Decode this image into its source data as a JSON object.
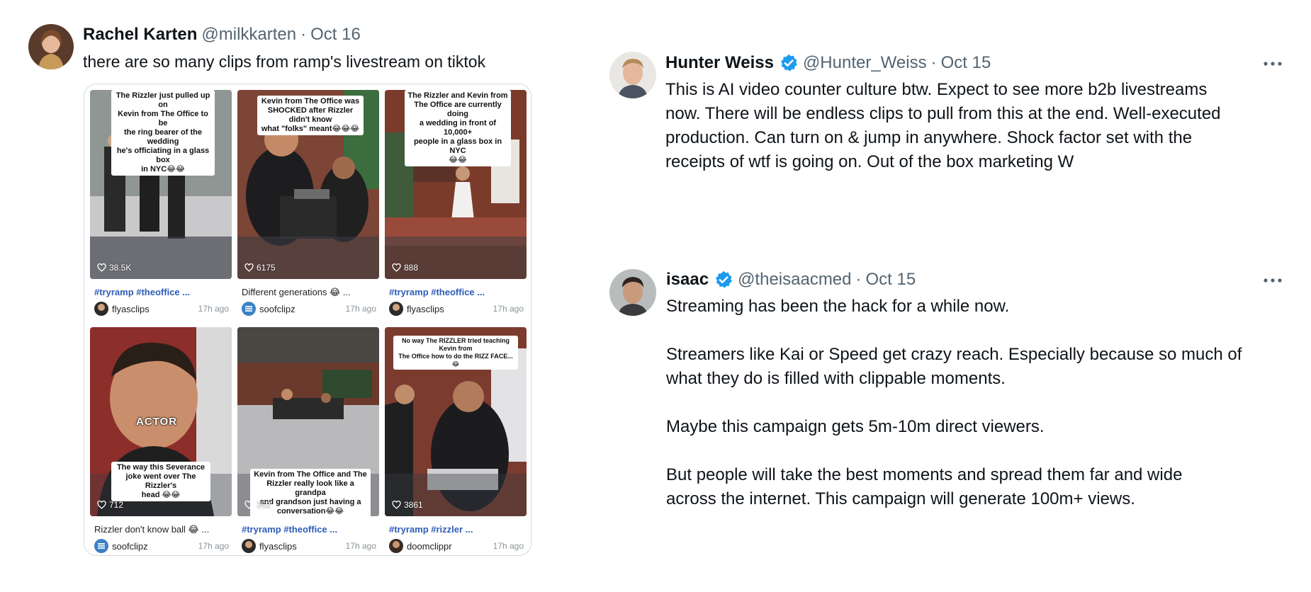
{
  "tweet1": {
    "name": "Rachel Karten",
    "handle": "@milkkarten",
    "separator": "·",
    "date": "Oct 16",
    "text": "there are so many clips from ramp's livestream on tiktok",
    "clips": [
      {
        "caption": [
          "The Rizzler just pulled up on",
          "Kevin from The Office to be",
          "the ring bearer of the wedding",
          "he's officiating in a glass box",
          "in NYC😂😂"
        ],
        "likes": "38.5K",
        "title": "#tryramp #theoffice ...",
        "user": "flyasclips",
        "ago": "17h ago"
      },
      {
        "caption": [
          "Kevin from The Office was",
          "SHOCKED after Rizzler didn't know",
          "what \"folks\" meant😂😂😂"
        ],
        "likes": "6175",
        "title": "Different generations 😂 ...",
        "user": "soofclipz",
        "ago": "17h ago"
      },
      {
        "caption": [
          "The Rizzler and Kevin from",
          "The Office are currently doing",
          "a wedding in front of 10,000+",
          "people in a glass box in NYC",
          "😂😂"
        ],
        "likes": "888",
        "title": "#tryramp #theoffice ...",
        "user": "flyasclips",
        "ago": "17h ago"
      },
      {
        "caption": [
          "The way this Severance",
          "joke went over The Rizzler's",
          "head 😂😂"
        ],
        "overlay": "ACTOR",
        "likes": "712",
        "title": "Rizzler don't know ball 😂 ...",
        "user": "soofclipz",
        "ago": "17h ago"
      },
      {
        "caption": [
          "Kevin from The Office and The",
          "Rizzler really look like a grandpa",
          "and grandson just having a",
          "conversation😂😂"
        ],
        "likes": "352",
        "title": "#tryramp #theoffice ...",
        "user": "flyasclips",
        "ago": "17h ago"
      },
      {
        "caption": [
          "No way The RIZZLER tried teaching Kevin from",
          "The Office how to do the RIZZ FACE... 😂"
        ],
        "likes": "3861",
        "title": "#tryramp #rizzler ...",
        "user": "doomclippr",
        "ago": "17h ago"
      }
    ]
  },
  "tweet2": {
    "name": "Hunter Weiss",
    "handle": "@Hunter_Weiss",
    "separator": "·",
    "date": "Oct 15",
    "lines": [
      "This is AI video counter culture btw. Expect to see more b2b livestreams",
      "now. There will be endless clips to pull from this at the end. Well-executed",
      "production. Can turn on  & jump in anywhere. Shock factor set with the",
      "receipts of wtf is going on. Out of the box marketing W"
    ]
  },
  "tweet3": {
    "name": "isaac",
    "handle": "@theisaacmed",
    "separator": "·",
    "date": "Oct 15",
    "lines": [
      "Streaming has been the hack for a while now.",
      "",
      "Streamers like Kai or Speed get crazy reach. Especially because so much of",
      "what they do is filled with clippable moments.",
      "",
      "Maybe this campaign gets 5m-10m direct viewers.",
      "",
      "But people will take the best moments and spread them far and wide",
      "across the internet. This campaign will generate 100m+ views."
    ]
  },
  "colors": {
    "verified": "#1d9bf0",
    "secondary_text": "#536471",
    "hashtag": "#2e5cb8"
  },
  "icons": {
    "verified": "verified-badge-icon",
    "more": "more-options-icon",
    "likes": "heart-icon"
  }
}
